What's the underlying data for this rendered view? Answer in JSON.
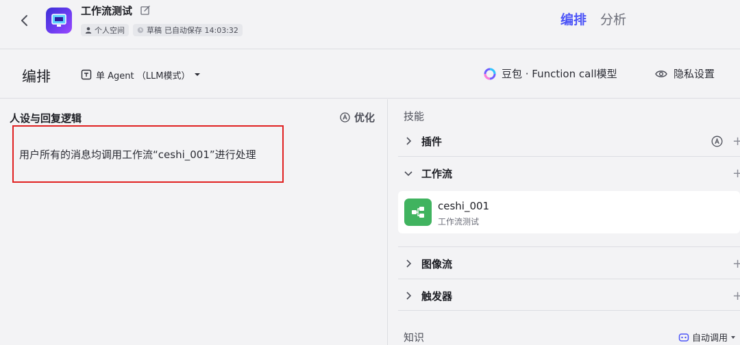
{
  "header": {
    "title": "工作流测试",
    "workspace": "个人空间",
    "draft": "草稿",
    "autosave": "已自动保存 14:03:32",
    "tabs": [
      {
        "label": "编排",
        "active": true
      },
      {
        "label": "分析",
        "active": false
      }
    ],
    "accent": "#4c54f7"
  },
  "toolbar": {
    "title": "编排",
    "mode": "单 Agent （LLM模式）",
    "model": "豆包 · Function call模型",
    "privacy": "隐私设置"
  },
  "persona": {
    "title": "人设与回复逻辑",
    "optimize": "优化",
    "prompt": "用户所有的消息均调用工作流“ceshi_001”进行处理",
    "highlight_color": "#e02020"
  },
  "skills": {
    "label": "技能",
    "plugins": "插件",
    "workflow": "工作流",
    "workflow_item": {
      "name": "ceshi_001",
      "desc": "工作流测试",
      "icon_color": "#40b35f"
    },
    "imageflow": "图像流",
    "trigger": "触发器"
  },
  "knowledge": {
    "label": "知识",
    "auto_call": "自动调用"
  }
}
